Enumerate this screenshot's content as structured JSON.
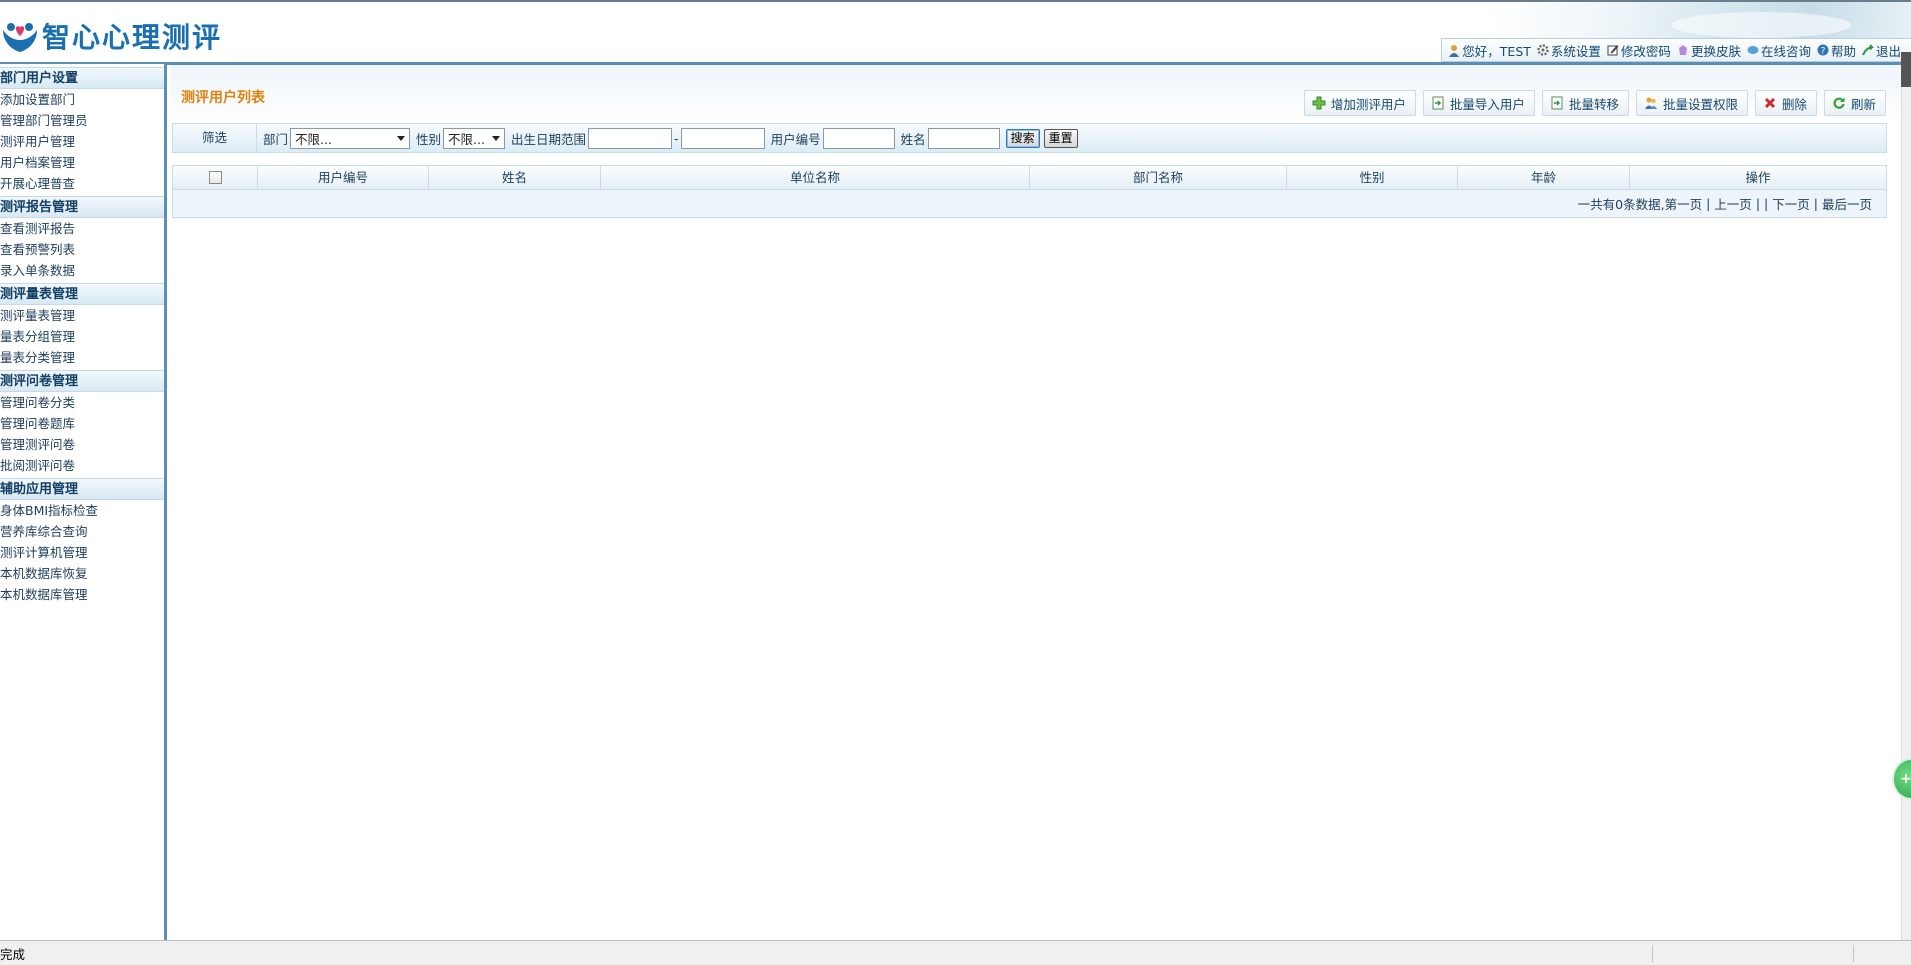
{
  "app": {
    "logo_text": "智心心理测评"
  },
  "userbar": {
    "greeting": "您好，TEST",
    "items": [
      "系统设置",
      "修改密码",
      "更换皮肤",
      "在线咨询",
      "帮助",
      "退出"
    ]
  },
  "sidebar": {
    "sections": [
      {
        "title": "部门用户设置",
        "items": [
          "添加设置部门",
          "管理部门管理员",
          "测评用户管理",
          "用户档案管理",
          "开展心理普查"
        ]
      },
      {
        "title": "测评报告管理",
        "items": [
          "查看测评报告",
          "查看预警列表",
          "录入单条数据"
        ]
      },
      {
        "title": "测评量表管理",
        "items": [
          "测评量表管理",
          "量表分组管理",
          "量表分类管理"
        ]
      },
      {
        "title": "测评问卷管理",
        "items": [
          "管理问卷分类",
          "管理问卷题库",
          "管理测评问卷",
          "批阅测评问卷"
        ]
      },
      {
        "title": "辅助应用管理",
        "items": [
          "身体BMI指标检查",
          "营养库综合查询",
          "测评计算机管理",
          "本机数据库恢复",
          "本机数据库管理"
        ]
      }
    ]
  },
  "main": {
    "title": "测评用户列表",
    "toolbar": [
      "增加测评用户",
      "批量导入用户",
      "批量转移",
      "批量设置权限",
      "删除",
      "刷新"
    ],
    "filter": {
      "label": "筛选",
      "dept_label": "部门",
      "dept_value": "不限...",
      "gender_label": "性别",
      "gender_value": "不限...",
      "birth_label": "出生日期范围",
      "range_sep": "-",
      "userid_label": "用户编号",
      "name_label": "姓名",
      "search_btn": "搜索",
      "reset_btn": "重置"
    },
    "table": {
      "columns": [
        "用户编号",
        "姓名",
        "单位名称",
        "部门名称",
        "性别",
        "年龄",
        "操作"
      ]
    },
    "pager": {
      "summary": "一共有0条数据,第一页",
      "prev": "上一页",
      "next": "下一页",
      "last": "最后一页"
    }
  },
  "statusbar": {
    "text": "完成"
  },
  "colors": {
    "accent": "#5b8fb4",
    "title": "#e0820f",
    "link": "#174a70"
  }
}
